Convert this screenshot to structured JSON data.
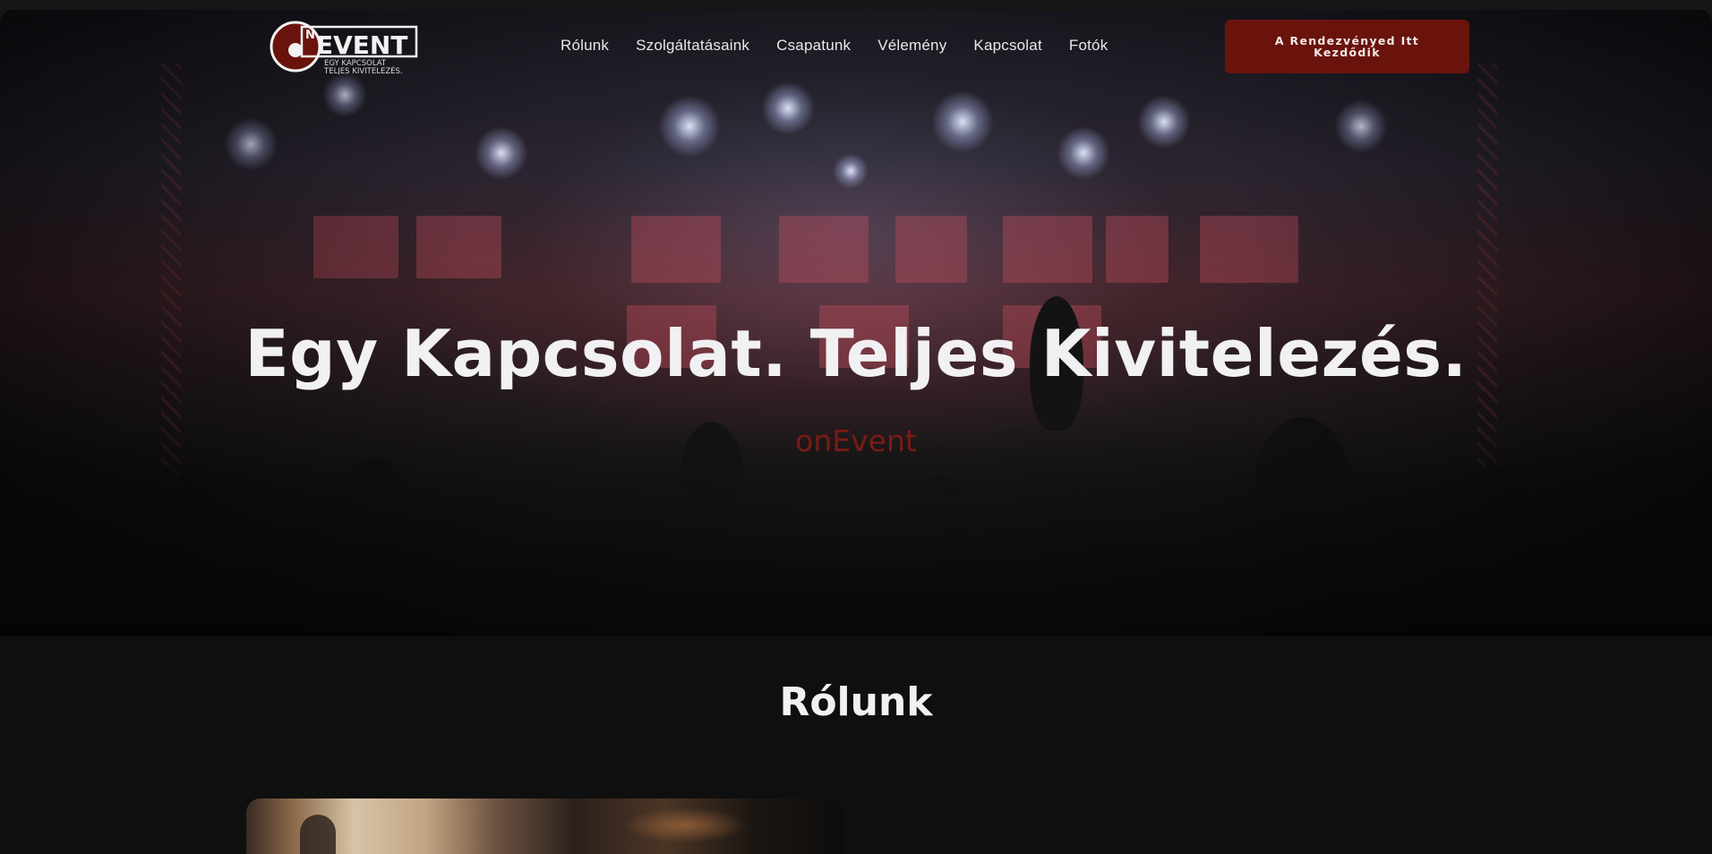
{
  "header": {
    "logo": {
      "wordmark": "EVENT",
      "prefix": "N",
      "tagline_line1": "EGY KAPCSOLAT",
      "tagline_line2": "TELJES KIVITELEZÉS."
    },
    "nav": [
      {
        "label": "Rólunk"
      },
      {
        "label": "Szolgáltatásaink"
      },
      {
        "label": "Csapatunk"
      },
      {
        "label": "Vélemény"
      },
      {
        "label": "Kapcsolat"
      },
      {
        "label": "Fotók"
      }
    ],
    "cta_label": "A Rendezvényed Itt Kezdődik"
  },
  "hero": {
    "title": "Egy Kapcsolat. Teljes Kivitelezés.",
    "subtitle": "onEvent"
  },
  "about": {
    "title": "Rólunk"
  },
  "colors": {
    "accent": "#6a130d",
    "subtitle": "#7a1b16",
    "background": "#0f0f0f"
  }
}
